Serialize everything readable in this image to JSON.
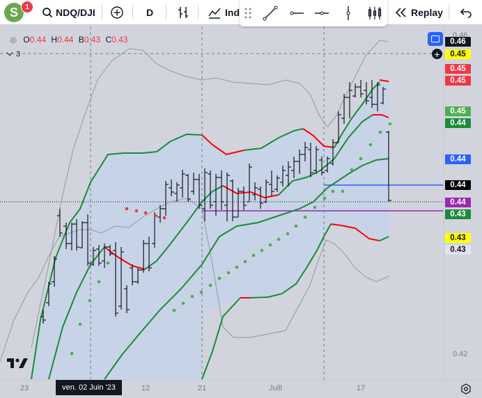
{
  "toolbar": {
    "avatar_letter": "S",
    "notification_count": "1",
    "symbol": "NDQ/DJI",
    "interval": "D",
    "indicators_label": "Ind",
    "replay_label": "Replay"
  },
  "legend": {
    "o_label": "O",
    "o_value": "0.44",
    "h_label": "H",
    "h_value": "0.44",
    "l_label": "B",
    "l_value": "0.43",
    "c_label": "C",
    "c_value": "0.43",
    "collapsed_count": "3"
  },
  "price_axis": {
    "ticks": {
      "t046": "0.46",
      "t043": "0.43",
      "t042": "0.42"
    },
    "tags": [
      {
        "text": "0.46",
        "bg": "#131722",
        "fg": "#ffffff"
      },
      {
        "text": "0.45",
        "bg": "#ffff00",
        "fg": "#131722"
      },
      {
        "text": "0.45",
        "bg": "#f23645",
        "fg": "#ffffff"
      },
      {
        "text": "0.45",
        "bg": "#f23645",
        "fg": "#ffffff"
      },
      {
        "text": "0.45",
        "bg": "#4caf50",
        "fg": "#ffffff"
      },
      {
        "text": "0.44",
        "bg": "#1b8a3a",
        "fg": "#ffffff"
      },
      {
        "text": "0.44",
        "bg": "#2962ff",
        "fg": "#ffffff"
      },
      {
        "text": "0.44",
        "bg": "#000000",
        "fg": "#ffffff"
      },
      {
        "text": "0.44",
        "bg": "#9c27b0",
        "fg": "#ffffff"
      },
      {
        "text": "0.43",
        "bg": "#1b8a3a",
        "fg": "#ffffff"
      },
      {
        "text": "0.43",
        "bg": "#ffff00",
        "fg": "#131722"
      },
      {
        "text": "0.43",
        "bg": "#e0e3eb",
        "fg": "#131722"
      }
    ]
  },
  "time_axis": {
    "labels": {
      "d23": "23",
      "d12": "12",
      "d21": "21",
      "juil": "Juill",
      "d17": "17"
    },
    "crosshair_label": "ven. 02 Juin '23"
  },
  "colors": {
    "background": "#d1d4dc",
    "band_fill": "#c5d3e8",
    "band_green": "#1b8a3a",
    "band_red": "#ff0000",
    "outer_band": "#9598a1",
    "psar_green": "#4caf50",
    "psar_red": "#f23645",
    "hline_blue": "#2962ff",
    "hline_purple": "#9c27b0"
  }
}
